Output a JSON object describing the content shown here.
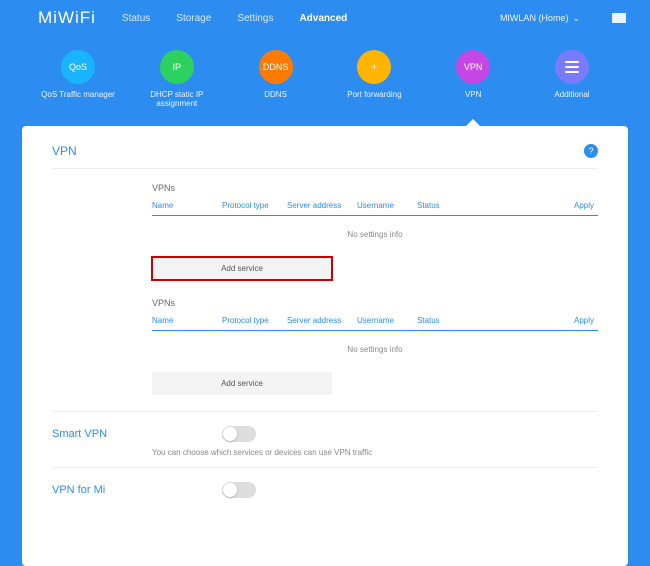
{
  "logo": "MiWiFi",
  "nav": {
    "status": "Status",
    "storage": "Storage",
    "settings": "Settings",
    "advanced": "Advanced"
  },
  "network_label": "MIWLAN (Home)",
  "tiles": {
    "qos": {
      "icon": "QoS",
      "label": "QoS Traffic manager",
      "color": "#19b4ff"
    },
    "ip": {
      "icon": "IP",
      "label": "DHCP static IP assignment",
      "color": "#2dd160"
    },
    "ddns": {
      "icon": "DDNS",
      "label": "DDNS",
      "color": "#ff7a00"
    },
    "port": {
      "icon": "+",
      "label": "Port forwarding",
      "color": "#ffb400"
    },
    "vpn": {
      "icon": "VPN",
      "label": "VPN",
      "color": "#c547e6"
    },
    "add": {
      "icon": "≡",
      "label": "Additional",
      "color": "#7a7aff"
    }
  },
  "panel": {
    "title": "VPN"
  },
  "vpns": {
    "heading": "VPNs",
    "cols": {
      "name": "Name",
      "proto": "Protocol type",
      "server": "Server address",
      "user": "Username",
      "status": "Status",
      "apply": "Apply"
    },
    "empty": "No settings info",
    "add": "Add service"
  },
  "smart": {
    "title": "Smart VPN",
    "desc": "You can choose which services or devices can use VPN traffic"
  },
  "vpnmi": {
    "title": "VPN for Mi"
  }
}
